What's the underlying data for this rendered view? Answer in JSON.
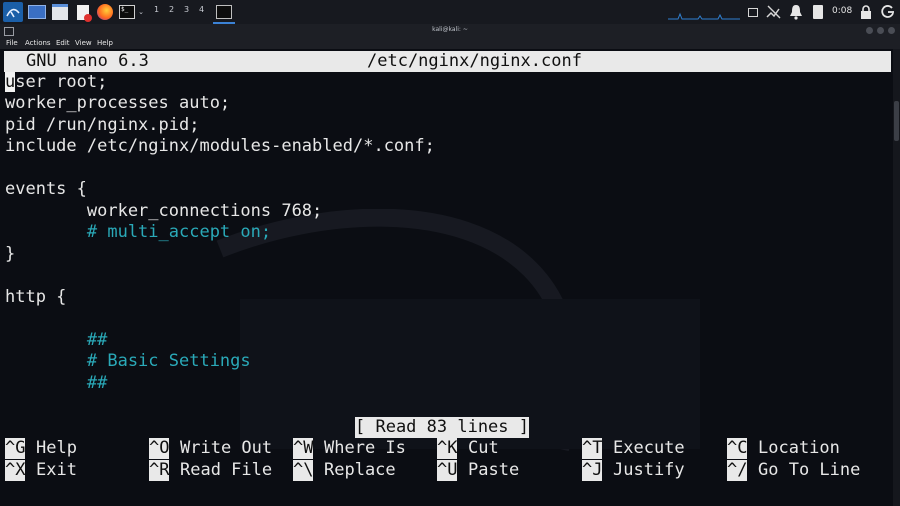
{
  "taskbar": {
    "workspaces": [
      "1",
      "2",
      "3",
      "4"
    ],
    "clock": "0:08",
    "terminal_icon_label": "$_"
  },
  "window": {
    "title": "kali@kali: ~",
    "menu": [
      "File",
      "Actions",
      "Edit",
      "View",
      "Help"
    ]
  },
  "nano": {
    "version": "GNU nano 6.3",
    "filename": "/etc/nginx/nginx.conf",
    "status": "[ Read 83 lines ]",
    "cursor_char": "u",
    "lines": [
      {
        "text": "ser root;",
        "comment": false,
        "first": true
      },
      {
        "text": "worker_processes auto;",
        "comment": false
      },
      {
        "text": "pid /run/nginx.pid;",
        "comment": false
      },
      {
        "text": "include /etc/nginx/modules-enabled/*.conf;",
        "comment": false
      },
      {
        "text": "",
        "comment": false
      },
      {
        "text": "events {",
        "comment": false
      },
      {
        "text": "        worker_connections 768;",
        "comment": false
      },
      {
        "text": "        # multi_accept on;",
        "comment": true
      },
      {
        "text": "}",
        "comment": false
      },
      {
        "text": "",
        "comment": false
      },
      {
        "text": "http {",
        "comment": false
      },
      {
        "text": "",
        "comment": false
      },
      {
        "text": "        ##",
        "comment": true
      },
      {
        "text": "        # Basic Settings",
        "comment": true
      },
      {
        "text": "        ##",
        "comment": true
      }
    ],
    "shortcuts_row1": [
      {
        "key": "^G",
        "label": "Help"
      },
      {
        "key": "^O",
        "label": "Write Out"
      },
      {
        "key": "^W",
        "label": "Where Is"
      },
      {
        "key": "^K",
        "label": "Cut"
      },
      {
        "key": "^T",
        "label": "Execute"
      },
      {
        "key": "^C",
        "label": "Location"
      }
    ],
    "shortcuts_row2": [
      {
        "key": "^X",
        "label": "Exit"
      },
      {
        "key": "^R",
        "label": "Read File"
      },
      {
        "key": "^\\",
        "label": "Replace"
      },
      {
        "key": "^U",
        "label": "Paste"
      },
      {
        "key": "^J",
        "label": "Justify"
      },
      {
        "key": "^/",
        "label": "Go To Line"
      }
    ]
  }
}
